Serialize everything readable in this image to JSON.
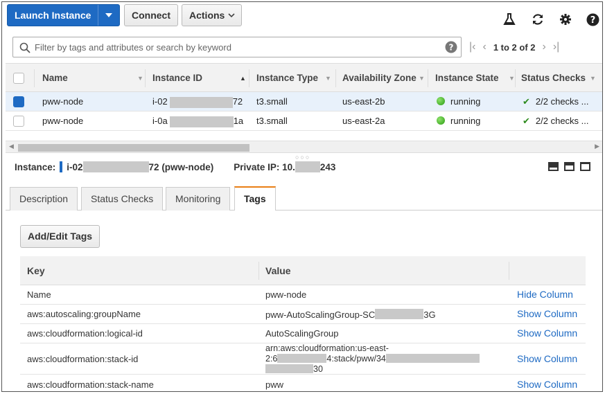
{
  "toolbar": {
    "launch_label": "Launch Instance",
    "connect_label": "Connect",
    "actions_label": "Actions"
  },
  "search": {
    "placeholder": "Filter by tags and attributes or search by keyword"
  },
  "pager": {
    "text": "1 to 2 of 2"
  },
  "table": {
    "headers": [
      "Name",
      "Instance ID",
      "Instance Type",
      "Availability Zone",
      "Instance State",
      "Status Checks"
    ],
    "rows": [
      {
        "name": "pww-node",
        "id_prefix": "i-02",
        "id_suffix": "72",
        "type": "t3.small",
        "az": "us-east-2b",
        "state": "running",
        "checks": "2/2 checks ...",
        "selected": true
      },
      {
        "name": "pww-node",
        "id_prefix": "i-0a",
        "id_suffix": "1a",
        "type": "t3.small",
        "az": "us-east-2a",
        "state": "running",
        "checks": "2/2 checks ...",
        "selected": false
      }
    ]
  },
  "detail": {
    "instance_label": "Instance:",
    "instance_prefix": "i-02",
    "instance_suffix": "72 (pww-node)",
    "private_ip_label": "Private IP: 10.",
    "private_ip_suffix": "243"
  },
  "tabs": [
    "Description",
    "Status Checks",
    "Monitoring",
    "Tags"
  ],
  "active_tab": "Tags",
  "tags": {
    "add_edit_label": "Add/Edit Tags",
    "headers": [
      "Key",
      "Value"
    ],
    "rows": [
      {
        "key": "Name",
        "value": "pww-node",
        "action": "Hide Column"
      },
      {
        "key": "aws:autoscaling:groupName",
        "value_prefix": "pww-AutoScalingGroup-SC",
        "value_suffix": "3G",
        "action": "Show Column"
      },
      {
        "key": "aws:cloudformation:logical-id",
        "value": "AutoScalingGroup",
        "action": "Show Column"
      },
      {
        "key": "aws:cloudformation:stack-id",
        "value_line1": "arn:aws:cloudformation:us-east-",
        "value_line2_prefix": "2:6",
        "value_line2_mid": "4:stack/pww/34",
        "value_line3_suffix": "30",
        "action": "Show Column"
      },
      {
        "key": "aws:cloudformation:stack-name",
        "value": "pww",
        "action": "Show Column"
      }
    ]
  },
  "colors": {
    "accent": "#1e6ac3",
    "active_tab": "#e97e13",
    "running": "#2a9b13"
  },
  "icons": [
    "flask-icon",
    "refresh-icon",
    "gear-icon",
    "help-icon",
    "search-icon",
    "clear-icon",
    "first-page-icon",
    "prev-page-icon",
    "next-page-icon",
    "last-page-icon"
  ]
}
